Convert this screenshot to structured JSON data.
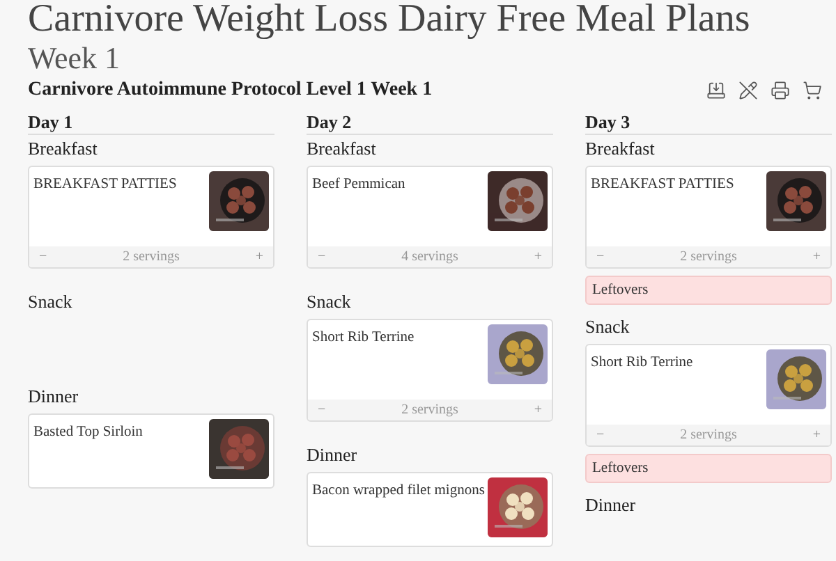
{
  "page_title": "Carnivore Weight Loss Dairy Free Meal Plans",
  "week_title": "Week 1",
  "plan_title": "Carnivore Autoimmune Protocol Level 1 Week 1",
  "toolbar": [
    {
      "kind": "save"
    },
    {
      "kind": "edit-off"
    },
    {
      "kind": "print"
    },
    {
      "kind": "cart"
    }
  ],
  "days": [
    {
      "label": "Day 1",
      "meals": [
        {
          "label": "Breakfast",
          "items": [
            {
              "kind": "recipe",
              "title": "BREAKFAST PATTIES",
              "decrement": "−",
              "servings": "2 servings",
              "increment": "+"
            }
          ]
        },
        {
          "label": "Snack"
        },
        {
          "label": "Dinner",
          "items": [
            {
              "kind": "recipe",
              "title": "Basted Top Sirloin"
            }
          ]
        }
      ]
    },
    {
      "label": "Day 2",
      "meals": [
        {
          "label": "Breakfast",
          "items": [
            {
              "kind": "recipe",
              "title": "Beef Pemmican",
              "decrement": "−",
              "servings": "4 servings",
              "increment": "+"
            }
          ]
        },
        {
          "label": "Snack",
          "items": [
            {
              "kind": "recipe",
              "title": "Short Rib Terrine",
              "decrement": "−",
              "servings": "2 servings",
              "increment": "+"
            }
          ]
        },
        {
          "label": "Dinner",
          "items": [
            {
              "kind": "recipe",
              "title": "Bacon wrapped filet mignons"
            }
          ]
        }
      ]
    },
    {
      "label": "Day 3",
      "meals": [
        {
          "label": "Breakfast",
          "items": [
            {
              "kind": "recipe",
              "title": "BREAKFAST PATTIES",
              "decrement": "−",
              "servings": "2 servings",
              "increment": "+"
            },
            {
              "kind": "leftovers",
              "title": "Leftovers"
            }
          ]
        },
        {
          "label": "Snack",
          "items": [
            {
              "kind": "recipe",
              "title": "Short Rib Terrine",
              "decrement": "−",
              "servings": "2 servings",
              "increment": "+"
            },
            {
              "kind": "leftovers",
              "title": "Leftovers"
            }
          ]
        },
        {
          "label": "Dinner"
        }
      ]
    }
  ]
}
